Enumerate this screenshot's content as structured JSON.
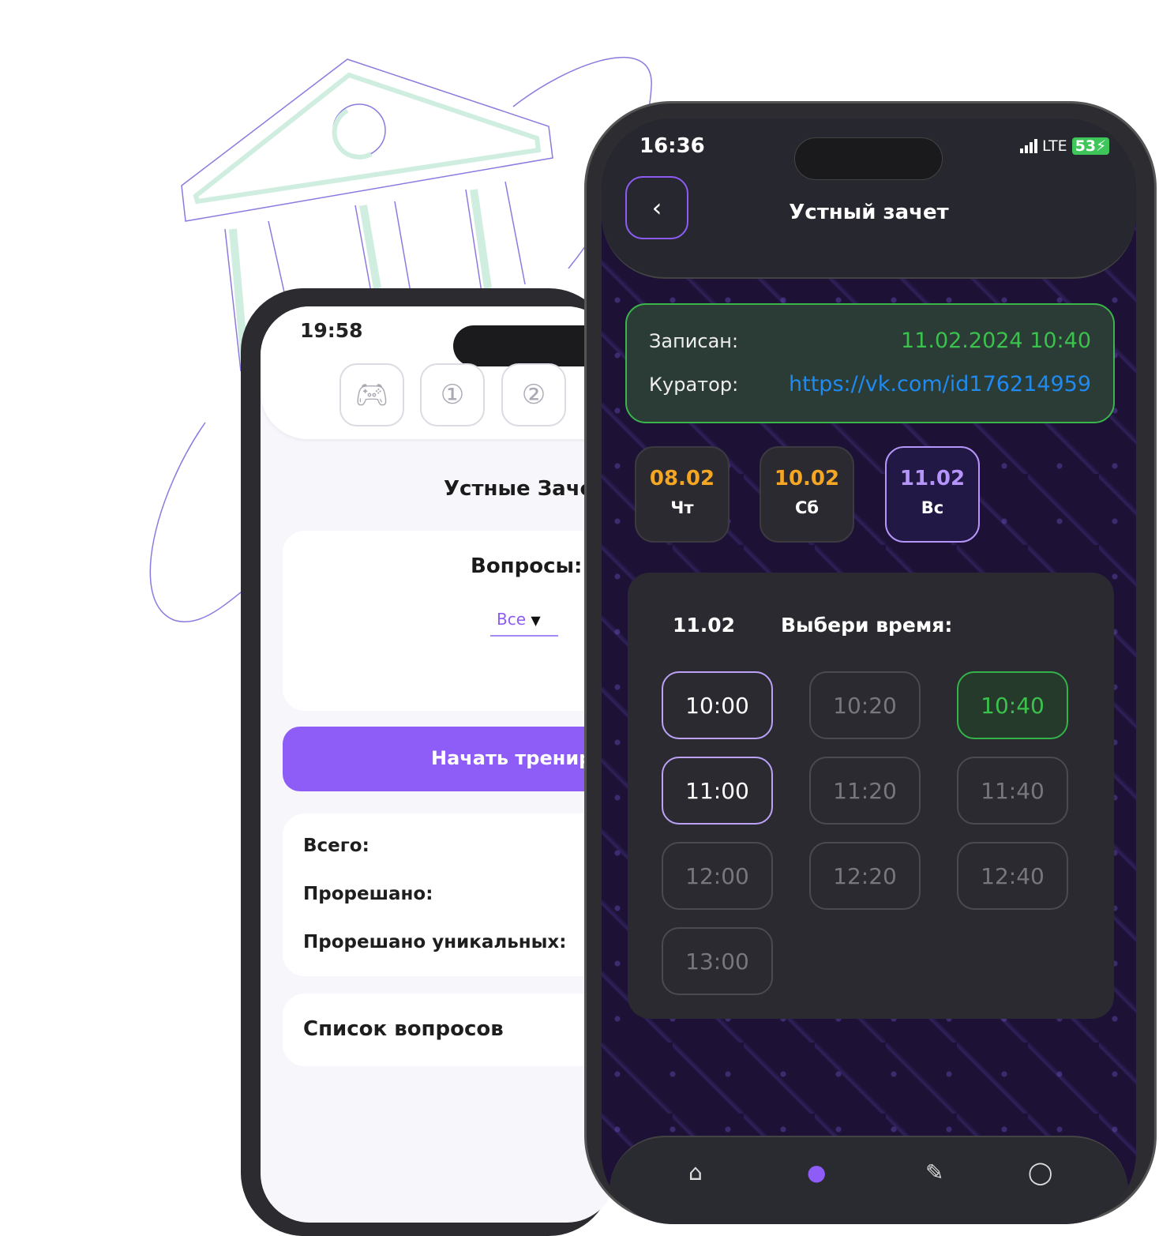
{
  "colors": {
    "accent": "#8e5cf7",
    "booked": "#3ac24d",
    "link": "#1f8af0",
    "date_orange": "#f5a623",
    "date_selected": "#b695fb"
  },
  "left_phone": {
    "status_time": "19:58",
    "top_icons": [
      {
        "icon": "gamepad-icon"
      },
      {
        "icon": "number-1-icon",
        "label": "1"
      },
      {
        "icon": "number-2-icon",
        "label": "2"
      }
    ],
    "title": "Устные Заче",
    "questions_label": "Вопросы:",
    "filter_value": "Все",
    "start_button": "Начать тренир",
    "stats": {
      "total": "Всего:",
      "solved": "Прорешано:",
      "solved_unique": "Прорешано уникальных:"
    },
    "question_list": "Список вопросов"
  },
  "right_phone": {
    "status_time": "16:36",
    "network": "LTE",
    "battery": "53",
    "title": "Устный зачет",
    "booking": {
      "enrolled_label": "Записан:",
      "enrolled_value": "11.02.2024 10:40",
      "curator_label": "Куратор:",
      "curator_value": "https://vk.com/id176214959"
    },
    "days": [
      {
        "date": "08.02",
        "weekday": "Чт",
        "state": "available"
      },
      {
        "date": "10.02",
        "weekday": "Сб",
        "state": "available"
      },
      {
        "date": "11.02",
        "weekday": "Вс",
        "state": "selected"
      }
    ],
    "panel": {
      "date": "11.02",
      "prompt": "Выбери время:"
    },
    "slots": [
      {
        "time": "10:00",
        "state": "selected"
      },
      {
        "time": "10:20",
        "state": "disabled"
      },
      {
        "time": "10:40",
        "state": "booked"
      },
      {
        "time": "11:00",
        "state": "selected"
      },
      {
        "time": "11:20",
        "state": "disabled"
      },
      {
        "time": "11:40",
        "state": "disabled"
      },
      {
        "time": "12:00",
        "state": "disabled"
      },
      {
        "time": "12:20",
        "state": "disabled"
      },
      {
        "time": "12:40",
        "state": "disabled"
      },
      {
        "time": "13:00",
        "state": "disabled"
      }
    ],
    "nav": [
      {
        "icon": "home-icon"
      },
      {
        "icon": "share-icon",
        "active": true
      },
      {
        "icon": "pencil-icon"
      },
      {
        "icon": "profile-icon"
      }
    ]
  }
}
